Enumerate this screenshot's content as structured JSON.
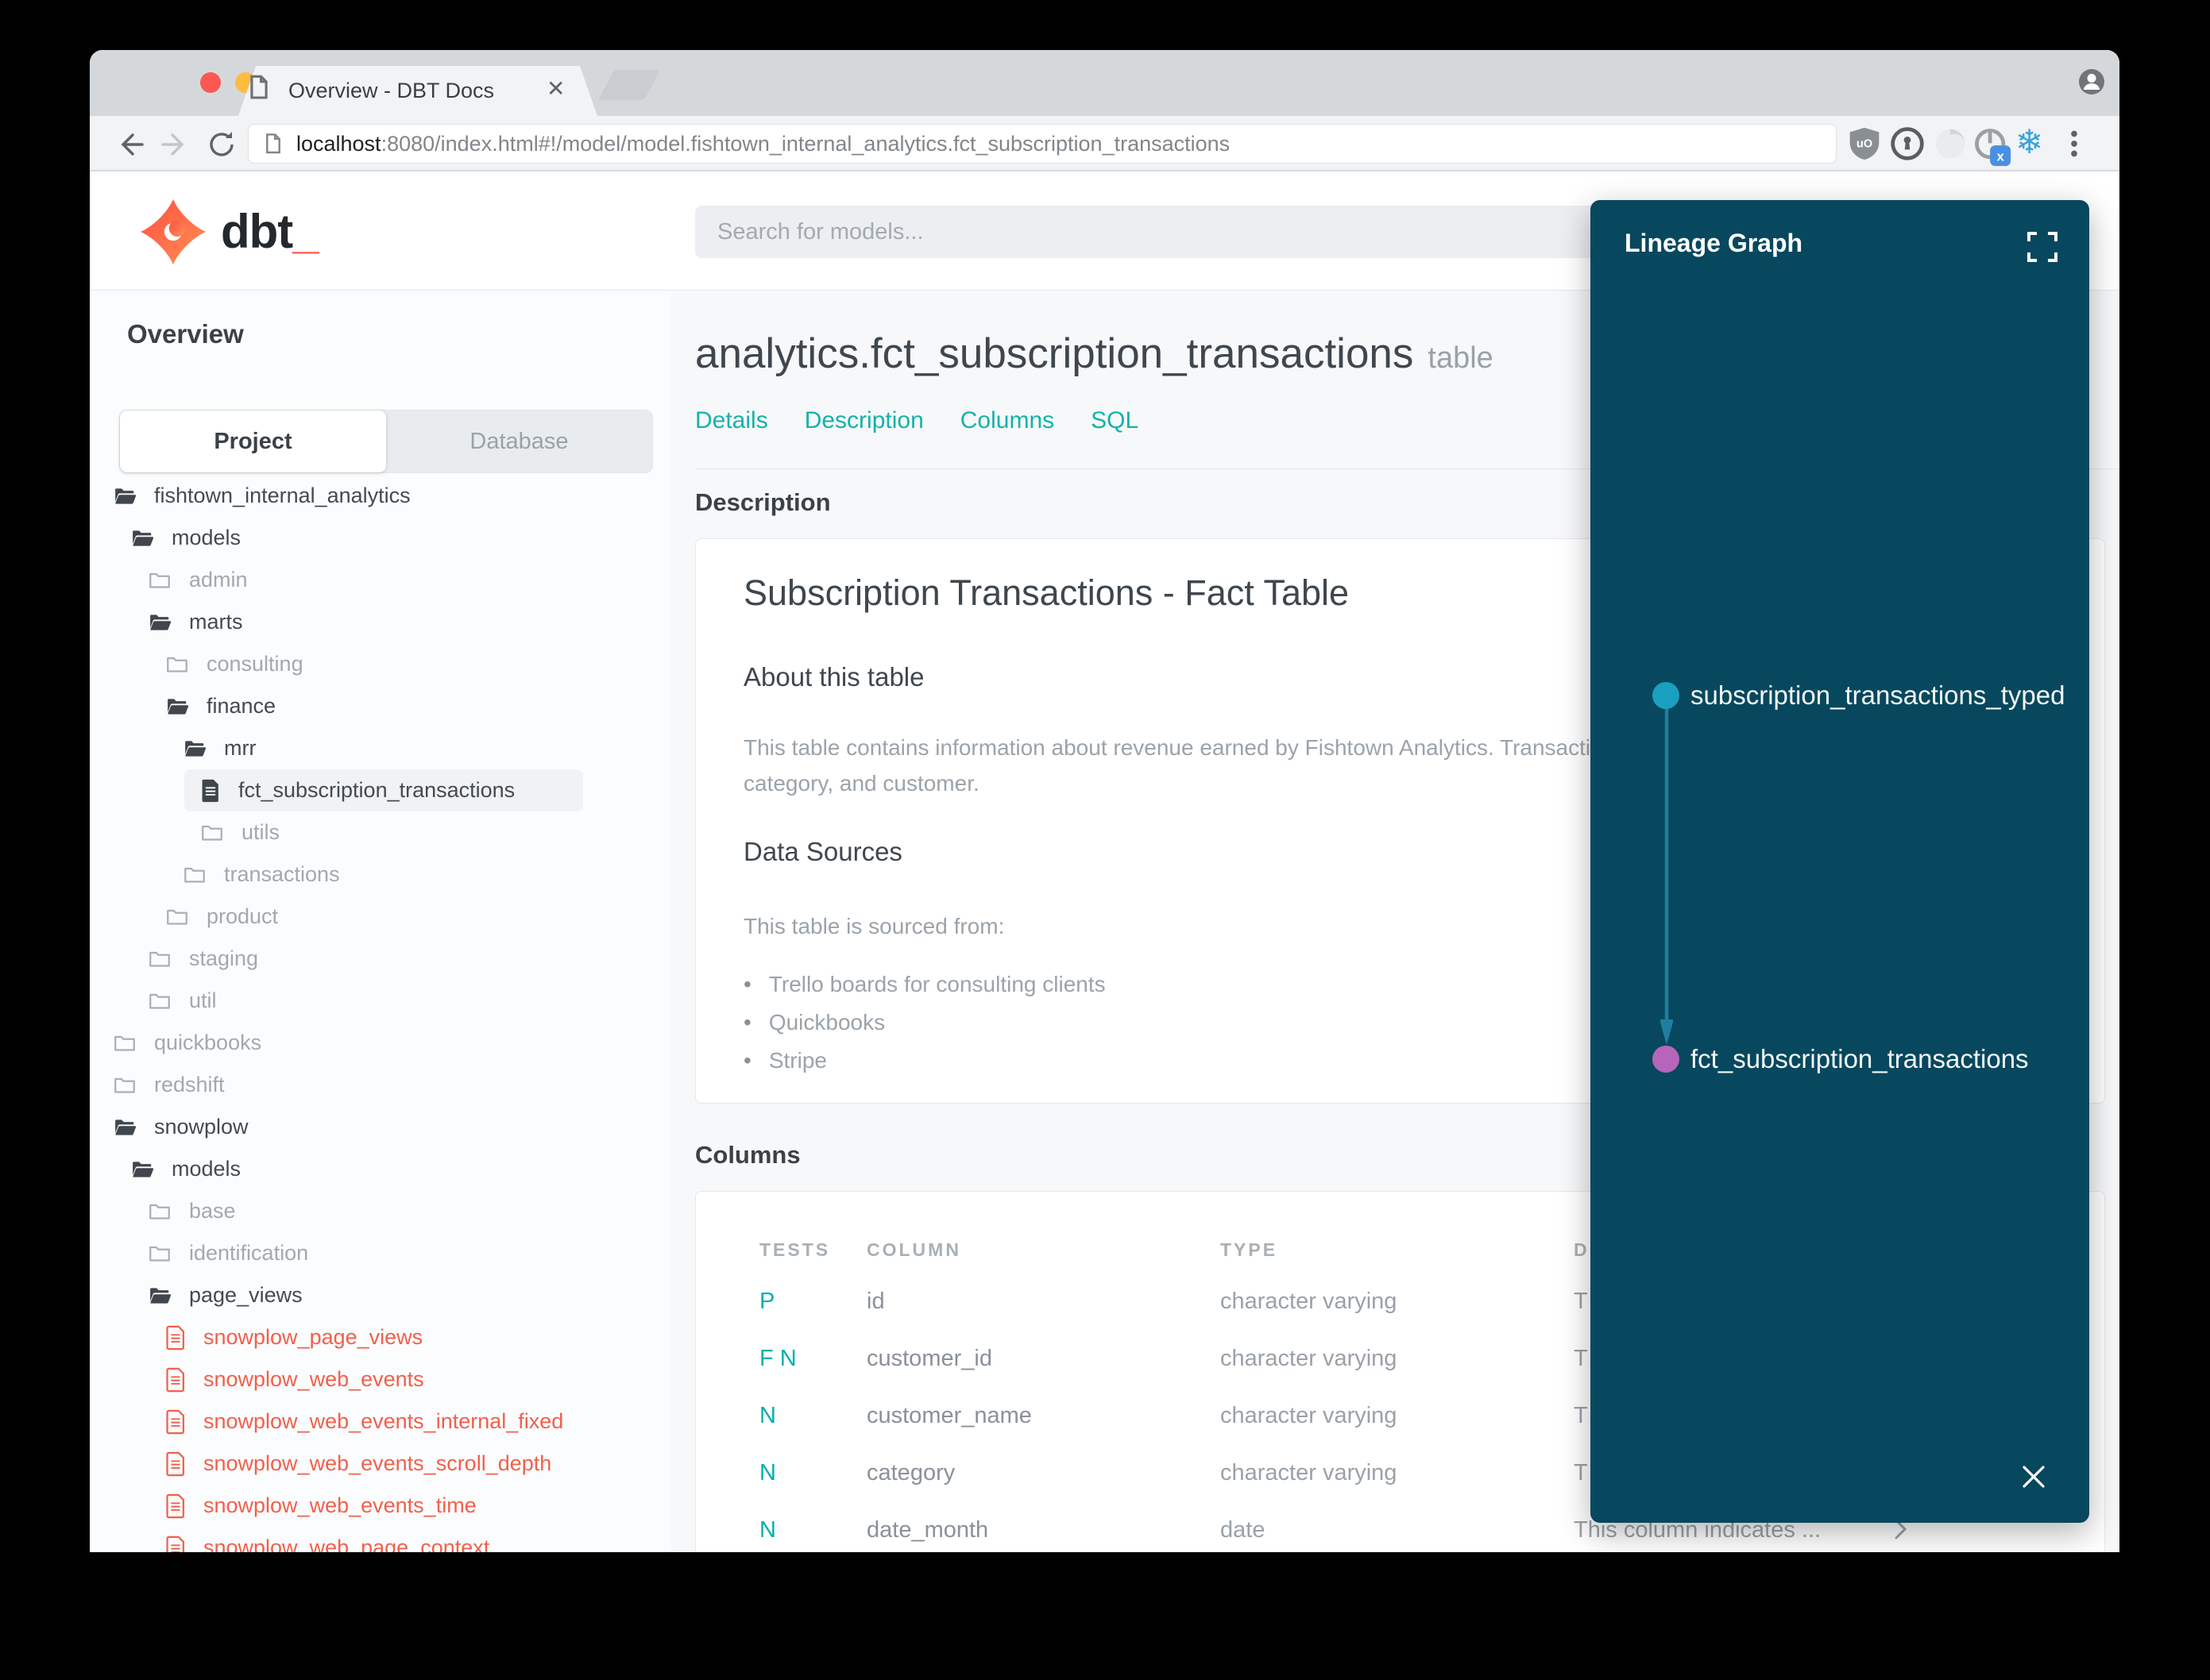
{
  "browser": {
    "tab_title": "Overview - DBT Docs",
    "url_host": "localhost",
    "url_rest": ":8080/index.html#!/model/model.fishtown_internal_analytics.fct_subscription_transactions"
  },
  "header": {
    "logo_text": "dbt",
    "logo_cursor": "_",
    "search_placeholder": "Search for models..."
  },
  "sidebar": {
    "section_title": "Overview",
    "tabs": [
      {
        "label": "Project",
        "active": true
      },
      {
        "label": "Database",
        "active": false
      }
    ],
    "tree": [
      {
        "label": "fishtown_internal_analytics",
        "level": 0,
        "icon": "folder-open"
      },
      {
        "label": "models",
        "level": 1,
        "icon": "folder-open"
      },
      {
        "label": "admin",
        "level": 2,
        "icon": "folder-closed"
      },
      {
        "label": "marts",
        "level": 2,
        "icon": "folder-open"
      },
      {
        "label": "consulting",
        "level": 3,
        "icon": "folder-closed"
      },
      {
        "label": "finance",
        "level": 3,
        "icon": "folder-open"
      },
      {
        "label": "mrr",
        "level": 4,
        "icon": "folder-open"
      },
      {
        "label": "fct_subscription_transactions",
        "level": 5,
        "icon": "file-selected",
        "selected": true
      },
      {
        "label": "utils",
        "level": 5,
        "icon": "folder-closed"
      },
      {
        "label": "transactions",
        "level": 4,
        "icon": "folder-closed"
      },
      {
        "label": "product",
        "level": 3,
        "icon": "folder-closed"
      },
      {
        "label": "staging",
        "level": 2,
        "icon": "folder-closed"
      },
      {
        "label": "util",
        "level": 2,
        "icon": "folder-closed"
      },
      {
        "label": "quickbooks",
        "level": 0,
        "icon": "folder-closed"
      },
      {
        "label": "redshift",
        "level": 0,
        "icon": "folder-closed"
      },
      {
        "label": "snowplow",
        "level": 0,
        "icon": "folder-open"
      },
      {
        "label": "models",
        "level": 1,
        "icon": "folder-open"
      },
      {
        "label": "base",
        "level": 2,
        "icon": "folder-closed"
      },
      {
        "label": "identification",
        "level": 2,
        "icon": "folder-closed"
      },
      {
        "label": "page_views",
        "level": 2,
        "icon": "folder-open"
      },
      {
        "label": "snowplow_page_views",
        "level": 3,
        "icon": "file-red"
      },
      {
        "label": "snowplow_web_events",
        "level": 3,
        "icon": "file-red"
      },
      {
        "label": "snowplow_web_events_internal_fixed",
        "level": 3,
        "icon": "file-red"
      },
      {
        "label": "snowplow_web_events_scroll_depth",
        "level": 3,
        "icon": "file-red"
      },
      {
        "label": "snowplow_web_events_time",
        "level": 3,
        "icon": "file-red"
      },
      {
        "label": "snowplow_web_page_context",
        "level": 3,
        "icon": "file-red"
      }
    ]
  },
  "main": {
    "title": "analytics.fct_subscription_transactions",
    "title_suffix": "table",
    "nav": [
      "Details",
      "Description",
      "Columns",
      "SQL"
    ],
    "description_section": {
      "heading": "Description",
      "card": {
        "title": "Subscription Transactions - Fact Table",
        "about_heading": "About this table",
        "about_lines": [
          "This table contains information about revenue earned by Fishtown Analytics. Transactions are grouped by type,",
          "category, and customer."
        ],
        "sources_heading": "Data Sources",
        "sources_intro": "This table is sourced from:",
        "sources": [
          "Trello boards for consulting clients",
          "Quickbooks",
          "Stripe"
        ]
      }
    },
    "columns_section": {
      "heading": "Columns",
      "table": {
        "headers": [
          "TESTS",
          "COLUMN",
          "TYPE",
          "DESCRIPTION"
        ],
        "rows": [
          {
            "tests": "P",
            "column": "id",
            "type": "character varying",
            "description": "T"
          },
          {
            "tests": "F N",
            "column": "customer_id",
            "type": "character varying",
            "description": "T"
          },
          {
            "tests": "N",
            "column": "customer_name",
            "type": "character varying",
            "description": "T"
          },
          {
            "tests": "N",
            "column": "category",
            "type": "character varying",
            "description": "T"
          },
          {
            "tests": "N",
            "column": "date_month",
            "type": "date",
            "description": "This column indicates ...",
            "expander": true
          }
        ]
      }
    }
  },
  "lineage": {
    "title": "Lineage Graph",
    "nodes": [
      {
        "label": "subscription_transactions_typed",
        "color": "#1b9fc0"
      },
      {
        "label": "fct_subscription_transactions",
        "color": "#b765bb"
      }
    ]
  },
  "colors": {
    "accent_teal": "#14b2ab",
    "model_red": "#f2604c",
    "panel_bg": "#07485e",
    "edge_teal": "#1f7fa0"
  }
}
